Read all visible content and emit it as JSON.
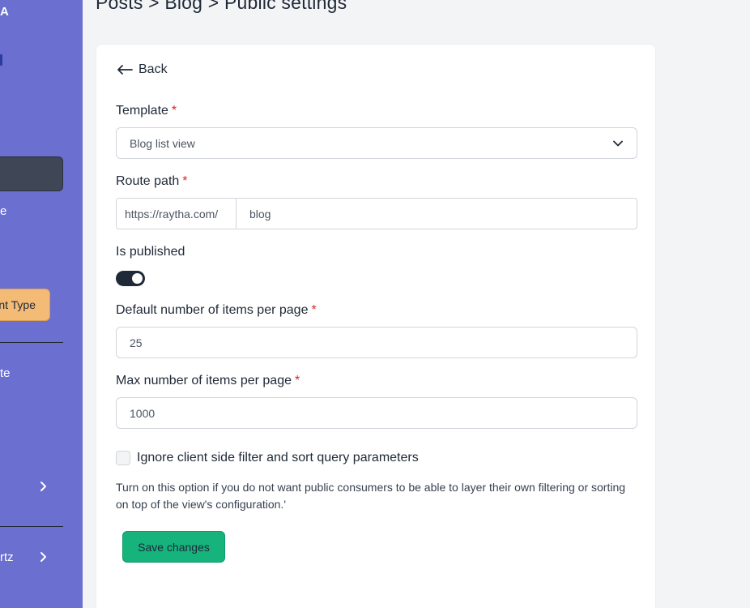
{
  "sidebar": {
    "brand": "A",
    "item_e": "e",
    "button_label": "nt Type",
    "item_te": "te",
    "item_rtz": "rtz"
  },
  "page": {
    "title": "Posts > Blog > Public settings"
  },
  "form": {
    "back_label": "Back",
    "template": {
      "label": "Template",
      "required": "*",
      "value": "Blog list view"
    },
    "route_path": {
      "label": "Route path",
      "required": "*",
      "prefix": "https://raytha.com/",
      "value": "blog"
    },
    "is_published": {
      "label": "Is published",
      "checked": true
    },
    "default_items": {
      "label": "Default number of items per page",
      "required": "*",
      "value": "25"
    },
    "max_items": {
      "label": "Max number of items per page",
      "required": "*",
      "value": "1000"
    },
    "ignore_params": {
      "label": "Ignore client side filter and sort query parameters",
      "checked": false,
      "help": "Turn on this option if you do not want public consumers to be able to layer their own filtering or sorting on top of the view's configuration.'"
    },
    "save_label": "Save changes"
  },
  "colors": {
    "sidebar_bg": "#6a6fd0",
    "accent_button": "#f3bb76",
    "save_button": "#16b37c",
    "required": "#dc2626"
  }
}
